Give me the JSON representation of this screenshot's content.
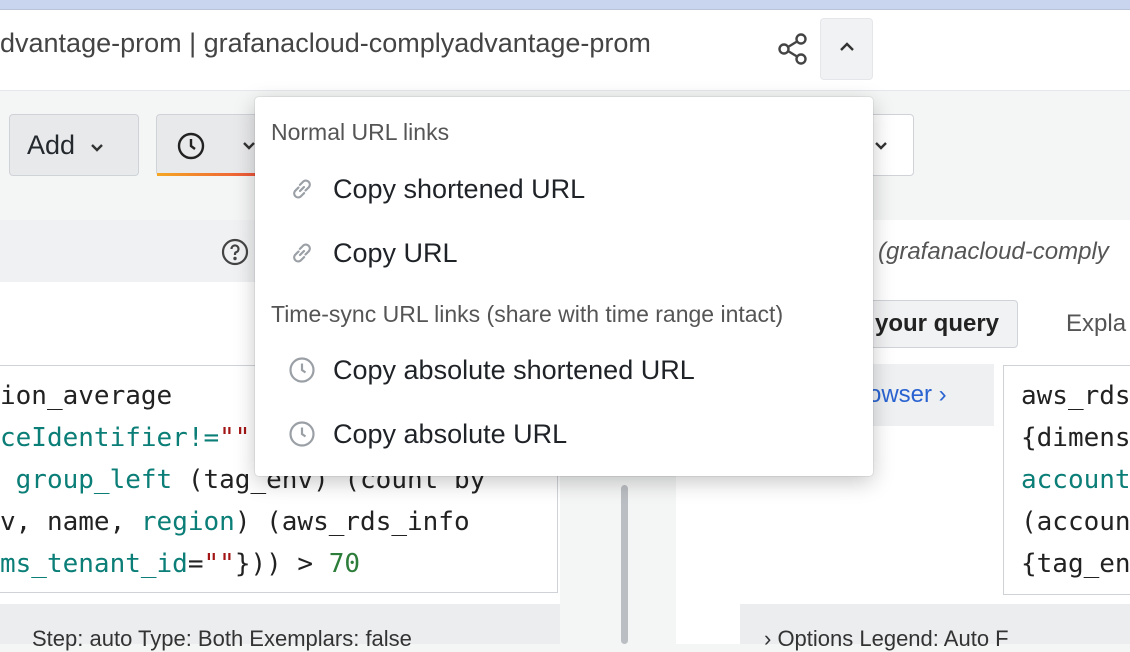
{
  "header": {
    "title": "dvantage-prom | grafanacloud-complyadvantage-prom",
    "share_icon": "share-icon",
    "collapse_icon": "chevron-up-icon"
  },
  "toolbar": {
    "add_label": "Add"
  },
  "share_menu": {
    "normal_header": "Normal URL links",
    "items_normal": [
      {
        "label": "Copy shortened URL",
        "icon": "link-icon"
      },
      {
        "label": "Copy URL",
        "icon": "link-icon"
      }
    ],
    "timesync_header": "Time-sync URL links (share with time range intact)",
    "items_timesync": [
      {
        "label": "Copy absolute shortened URL",
        "icon": "clock-icon"
      },
      {
        "label": "Copy absolute URL",
        "icon": "clock-icon"
      }
    ]
  },
  "left_query": {
    "line1": "ion_average",
    "line2_a": "ceIdentifier!=",
    "line2_b": "\"\"",
    "line3_a": " group_left ",
    "line3_b": "(tag_env) (count by",
    "line4_a": "v, name, ",
    "line4_b": "region",
    "line4_c": ") (aws_rds_info",
    "line5_a": "ms_tenant_id",
    "line5_b": "=",
    "line5_c": "\"\"",
    "line5_d": "})) > ",
    "line5_e": "70",
    "options": "Step: auto    Type: Both    Exemplars: false"
  },
  "right_panel": {
    "title": "(grafanacloud-comply",
    "your_query": "your query",
    "explain": "Expla",
    "browser": "rowser ›",
    "code_lines": [
      "aws_rds",
      "{dimens",
      "account",
      "(accoun",
      "{tag_en"
    ],
    "options": "›  Options   Legend: Auto   F"
  }
}
